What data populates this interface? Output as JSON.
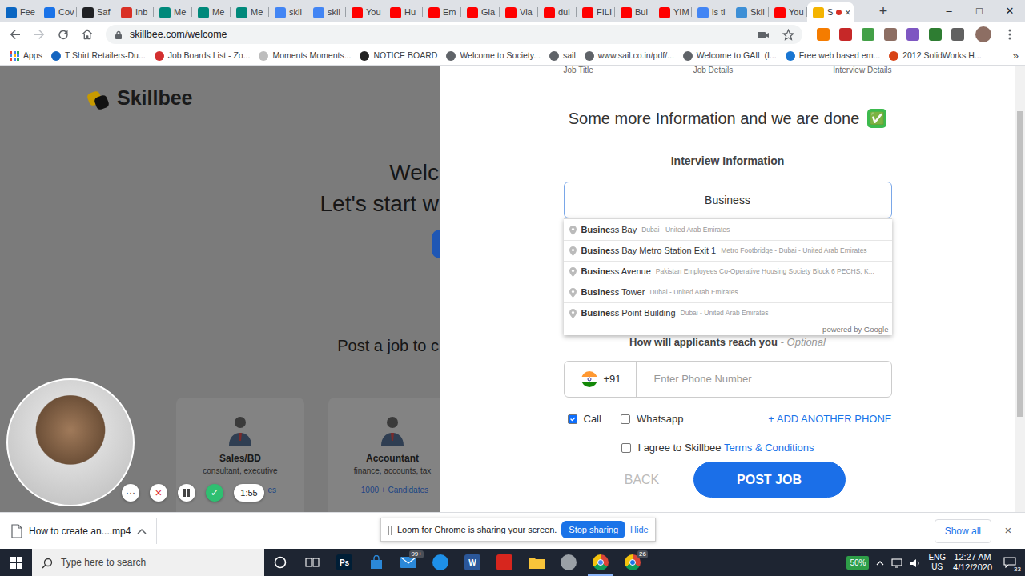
{
  "browser": {
    "tabs": [
      {
        "label": "Fee",
        "selected": false,
        "recording": false,
        "color": "#0a66c2"
      },
      {
        "label": "Cov",
        "selected": false,
        "recording": false,
        "color": "#1a73e8"
      },
      {
        "label": "Saf",
        "selected": false,
        "recording": false,
        "color": "#202124"
      },
      {
        "label": "Inb",
        "selected": false,
        "recording": false,
        "color": "#d93025"
      },
      {
        "label": "Me",
        "selected": false,
        "recording": false,
        "color": "#00897b"
      },
      {
        "label": "Me",
        "selected": false,
        "recording": false,
        "color": "#00897b"
      },
      {
        "label": "Me",
        "selected": false,
        "recording": false,
        "color": "#00897b"
      },
      {
        "label": "skil",
        "selected": false,
        "recording": false,
        "color": "#4285f4"
      },
      {
        "label": "skil",
        "selected": false,
        "recording": false,
        "color": "#4285f4"
      },
      {
        "label": "You",
        "selected": false,
        "recording": false,
        "color": "#ff0000"
      },
      {
        "label": "Hu",
        "selected": false,
        "recording": false,
        "color": "#ff0000"
      },
      {
        "label": "Em",
        "selected": false,
        "recording": false,
        "color": "#ff0000"
      },
      {
        "label": "Gla",
        "selected": false,
        "recording": false,
        "color": "#ff0000"
      },
      {
        "label": "Via",
        "selected": false,
        "recording": false,
        "color": "#ff0000"
      },
      {
        "label": "dul",
        "selected": false,
        "recording": false,
        "color": "#ff0000"
      },
      {
        "label": "FILI",
        "selected": false,
        "recording": false,
        "color": "#ff0000"
      },
      {
        "label": "Bul",
        "selected": false,
        "recording": false,
        "color": "#ff0000"
      },
      {
        "label": "YIM",
        "selected": false,
        "recording": false,
        "color": "#ff0000"
      },
      {
        "label": "is tl",
        "selected": false,
        "recording": false,
        "color": "#4285f4"
      },
      {
        "label": "Skil",
        "selected": false,
        "recording": false,
        "color": "#3d8fd6"
      },
      {
        "label": "You",
        "selected": false,
        "recording": false,
        "color": "#ff0000"
      },
      {
        "label": "S",
        "selected": true,
        "recording": true,
        "color": "#f4b400"
      }
    ],
    "tab_close": "×",
    "new_tab": "+",
    "window_controls": [
      "–",
      "□",
      "✕"
    ],
    "address": "skillbee.com/welcome",
    "bookmarks": [
      {
        "label": "Apps",
        "kind": "grid",
        "color": "#4285f4"
      },
      {
        "label": "T Shirt Retailers-Du...",
        "kind": "site",
        "color": "#1565c0"
      },
      {
        "label": "Job Boards List - Zo...",
        "kind": "site",
        "color": "#d32f2f"
      },
      {
        "label": "Moments Moments...",
        "kind": "site",
        "color": "#bdbdbd"
      },
      {
        "label": "NOTICE BOARD",
        "kind": "site",
        "color": "#212121"
      },
      {
        "label": "Welcome to Society...",
        "kind": "site",
        "color": "#5f6368"
      },
      {
        "label": "sail",
        "kind": "site",
        "color": "#5f6368"
      },
      {
        "label": "www.sail.co.in/pdf/...",
        "kind": "site",
        "color": "#5f6368"
      },
      {
        "label": "Welcome to GAIL (I...",
        "kind": "site",
        "color": "#5f6368"
      },
      {
        "label": "Free web based em...",
        "kind": "site",
        "color": "#1976d2"
      },
      {
        "label": "2012 SolidWorks H...",
        "kind": "site",
        "color": "#d84315"
      }
    ],
    "bookmarks_more": "»"
  },
  "page": {
    "logo": "Skillbee",
    "heading": [
      "Welc",
      "Let's start w"
    ],
    "prompt": "Post a job to c",
    "categories": [
      {
        "title": "Sales/BD",
        "subtitle": "consultant, executive",
        "count": "es"
      },
      {
        "title": "Accountant",
        "subtitle": "finance, accounts, tax",
        "count": "1000 + Candidates"
      }
    ]
  },
  "form": {
    "steps": [
      "Job Title",
      "Job Details",
      "Interview Details"
    ],
    "title": "Some more Information and we are done",
    "title_icon": "✅",
    "section": "Interview Information",
    "location_value": "Business",
    "suggestions": [
      {
        "match": "Busine",
        "rest": "ss Bay",
        "secondary": "Dubai - United Arab Emirates"
      },
      {
        "match": "Busine",
        "rest": "ss Bay Metro Station Exit 1",
        "secondary": "Metro Footbridge - Dubai - United Arab Emirates"
      },
      {
        "match": "Busine",
        "rest": "ss Avenue",
        "secondary": "Pakistan Employees Co-Operative Housing Society Block 6 PECHS, K..."
      },
      {
        "match": "Busine",
        "rest": "ss Tower",
        "secondary": "Dubai - United Arab Emirates"
      },
      {
        "match": "Busine",
        "rest": "ss Point Building",
        "secondary": "Dubai - United Arab Emirates"
      }
    ],
    "powered_by": "powered by Google",
    "reach_label": "How will applicants reach you",
    "reach_optional": "- Optional",
    "country_code": "+91",
    "phone_placeholder": "Enter Phone Number",
    "contact_methods": [
      {
        "label": "Call",
        "checked": true
      },
      {
        "label": "Whatsapp",
        "checked": false
      }
    ],
    "add_phone": "+ ADD ANOTHER PHONE",
    "agree": {
      "checked": false,
      "text": "I agree to Skillbee",
      "link": "Terms & Conditions"
    },
    "back": "BACK",
    "post": "POST JOB"
  },
  "loom": {
    "menu": "···",
    "cancel": "×",
    "done": "✓",
    "timer": "1:55",
    "banner": {
      "message": "Loom for Chrome is sharing your screen.",
      "stop": "Stop sharing",
      "hide": "Hide"
    }
  },
  "downloads": {
    "file": "How to create an....mp4",
    "show_all": "Show all",
    "close": "×"
  },
  "taskbar": {
    "search_placeholder": "Type here to search",
    "apps": [
      {
        "kind": "ring",
        "color": "#ffffff",
        "active": false
      },
      {
        "kind": "taskview",
        "color": "#ffffff",
        "active": false
      },
      {
        "kind": "tile",
        "color": "#001e36",
        "glyph": "Ps",
        "active": false
      },
      {
        "kind": "bag",
        "color": "#2b88d8",
        "active": false
      },
      {
        "kind": "envelope",
        "color": "#2b88d8",
        "badge": "99+",
        "active": false
      },
      {
        "kind": "circle",
        "color": "#1e90e8",
        "active": false
      },
      {
        "kind": "tile",
        "color": "#2b579a",
        "glyph": "W",
        "active": false
      },
      {
        "kind": "tile",
        "color": "#d7261e",
        "active": false
      },
      {
        "kind": "folder",
        "color": "#f8c43a",
        "active": false
      },
      {
        "kind": "circle",
        "color": "#9aa0a6",
        "active": false
      },
      {
        "kind": "chrome",
        "color": "#4285f4",
        "active": true
      },
      {
        "kind": "chrome",
        "color": "#1a73e8",
        "badge": "26",
        "active": false
      }
    ],
    "battery": "50%",
    "lang": "ENG",
    "region": "US",
    "time": "12:27 AM",
    "date": "4/12/2020",
    "notifications": "33"
  }
}
